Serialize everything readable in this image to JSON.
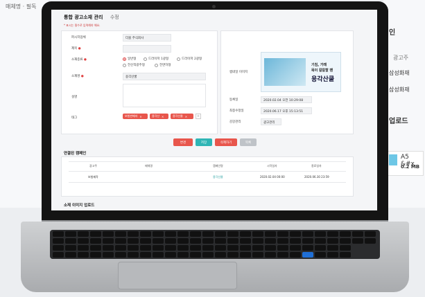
{
  "background": {
    "left_tab": "매체명 · 필독",
    "right_section": "인",
    "right_col_header": "광고주",
    "right_rows": [
      "삼성화재",
      "삼성화재"
    ],
    "right_upload_title": "업로드",
    "file_name": "A5 &#x",
    "file_size": "0.2 MB"
  },
  "page": {
    "title": "통합 광고소재 관리",
    "tab": "수정",
    "required_note": "* 표시는 필수로 입력해야 해요."
  },
  "form": {
    "advertiser_label": "퍼시지업체",
    "advertiser_value": "더블 주식회사",
    "title_label": "제목",
    "type_label": "소재종류",
    "type_options": [
      "일반형",
      "드라이저 1광형",
      "드라이저 2광형",
      "전신적광주형",
      "전면하형"
    ],
    "name_label": "소재명",
    "name_value": "용각산쿨",
    "desc_label": "설명",
    "tags_label": "태그",
    "tags": [
      "보험판매자",
      "용각산",
      "용각산쿨"
    ],
    "tag_plus": "+"
  },
  "details": {
    "image_label": "썸네일 이미지",
    "thumb_line1": "기침, 가래",
    "thumb_line2": "목이 칼칼할 땐",
    "thumb_line3": "용각산쿨",
    "reg_label": "등록일",
    "reg_value": "2020.02.04 오전 10:29:08",
    "mod_label": "최종수정일",
    "mod_value": "2020.06.17 오후 15:13:51",
    "editor_label": "감강관리",
    "editor_value": "광고관리"
  },
  "buttons": {
    "prev": "변경",
    "save": "저장",
    "delete": "삭제하기",
    "list": "목록"
  },
  "linked": {
    "title": "연결된 캠페인",
    "headers": [
      "광고주",
      "매체명",
      "캠페인명",
      "시작일자",
      "종료일자"
    ],
    "row": [
      "보험제작",
      "",
      "용각산쿨",
      "2020.02.04 00:00",
      "2020.06.30 23:59"
    ]
  },
  "upload_title": "소재 이미지 업로드"
}
